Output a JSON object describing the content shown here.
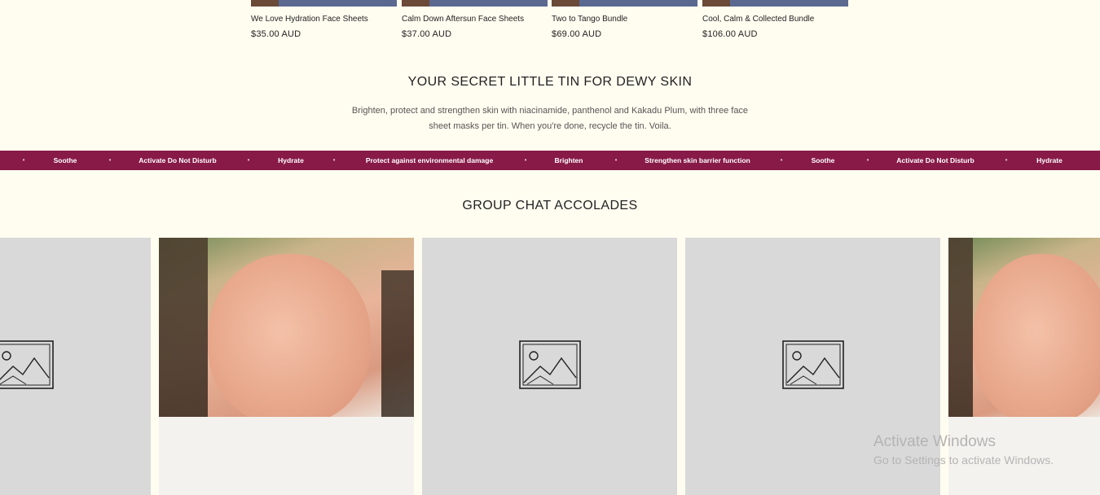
{
  "products": [
    {
      "name": "We Love Hydration Face Sheets",
      "price": "$35.00 AUD"
    },
    {
      "name": "Calm Down Aftersun Face Sheets",
      "price": "$37.00 AUD"
    },
    {
      "name": "Two to Tango Bundle",
      "price": "$69.00 AUD"
    },
    {
      "name": "Cool, Calm & Collected Bundle",
      "price": "$106.00 AUD"
    }
  ],
  "tin_section": {
    "title": "YOUR SECRET LITTLE TIN FOR DEWY SKIN",
    "description_line1": "Brighten, protect and strengthen skin with niacinamide, panthenol and Kakadu Plum, with three face",
    "description_line2": "sheet masks per tin. When you're done, recycle the tin. Voila."
  },
  "ticker": {
    "background": "#881a48",
    "separator": "•",
    "items": [
      "Soothe",
      "Activate Do Not Disturb",
      "Hydrate",
      "Protect against environmental damage",
      "Brighten",
      "Strengthen skin barrier function",
      "Soothe",
      "Activate Do Not Disturb",
      "Hydrate"
    ]
  },
  "accolades": {
    "title": "GROUP CHAT ACCOLADES",
    "tiles": [
      {
        "type": "placeholder",
        "icon": "image-placeholder-icon"
      },
      {
        "type": "photo",
        "alt": "selfie"
      },
      {
        "type": "placeholder",
        "icon": "image-placeholder-icon"
      },
      {
        "type": "placeholder",
        "icon": "image-placeholder-icon"
      },
      {
        "type": "photo",
        "alt": "selfie"
      }
    ]
  },
  "watermark": {
    "title": "Activate Windows",
    "subtitle": "Go to Settings to activate Windows."
  }
}
